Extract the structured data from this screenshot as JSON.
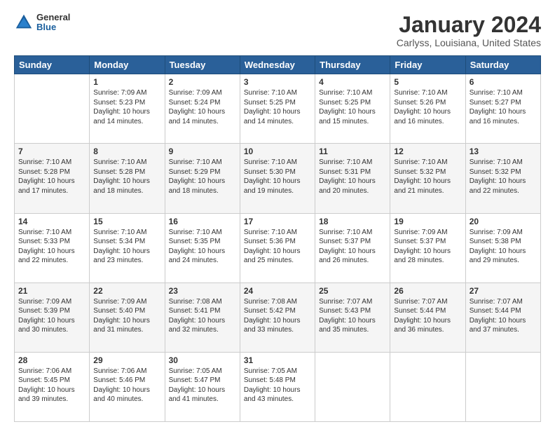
{
  "logo": {
    "line1": "General",
    "line2": "Blue"
  },
  "title": "January 2024",
  "subtitle": "Carlyss, Louisiana, United States",
  "weekdays": [
    "Sunday",
    "Monday",
    "Tuesday",
    "Wednesday",
    "Thursday",
    "Friday",
    "Saturday"
  ],
  "weeks": [
    [
      {
        "day": "",
        "info": ""
      },
      {
        "day": "1",
        "info": "Sunrise: 7:09 AM\nSunset: 5:23 PM\nDaylight: 10 hours\nand 14 minutes."
      },
      {
        "day": "2",
        "info": "Sunrise: 7:09 AM\nSunset: 5:24 PM\nDaylight: 10 hours\nand 14 minutes."
      },
      {
        "day": "3",
        "info": "Sunrise: 7:10 AM\nSunset: 5:25 PM\nDaylight: 10 hours\nand 14 minutes."
      },
      {
        "day": "4",
        "info": "Sunrise: 7:10 AM\nSunset: 5:25 PM\nDaylight: 10 hours\nand 15 minutes."
      },
      {
        "day": "5",
        "info": "Sunrise: 7:10 AM\nSunset: 5:26 PM\nDaylight: 10 hours\nand 16 minutes."
      },
      {
        "day": "6",
        "info": "Sunrise: 7:10 AM\nSunset: 5:27 PM\nDaylight: 10 hours\nand 16 minutes."
      }
    ],
    [
      {
        "day": "7",
        "info": "Sunrise: 7:10 AM\nSunset: 5:28 PM\nDaylight: 10 hours\nand 17 minutes."
      },
      {
        "day": "8",
        "info": "Sunrise: 7:10 AM\nSunset: 5:28 PM\nDaylight: 10 hours\nand 18 minutes."
      },
      {
        "day": "9",
        "info": "Sunrise: 7:10 AM\nSunset: 5:29 PM\nDaylight: 10 hours\nand 18 minutes."
      },
      {
        "day": "10",
        "info": "Sunrise: 7:10 AM\nSunset: 5:30 PM\nDaylight: 10 hours\nand 19 minutes."
      },
      {
        "day": "11",
        "info": "Sunrise: 7:10 AM\nSunset: 5:31 PM\nDaylight: 10 hours\nand 20 minutes."
      },
      {
        "day": "12",
        "info": "Sunrise: 7:10 AM\nSunset: 5:32 PM\nDaylight: 10 hours\nand 21 minutes."
      },
      {
        "day": "13",
        "info": "Sunrise: 7:10 AM\nSunset: 5:32 PM\nDaylight: 10 hours\nand 22 minutes."
      }
    ],
    [
      {
        "day": "14",
        "info": "Sunrise: 7:10 AM\nSunset: 5:33 PM\nDaylight: 10 hours\nand 22 minutes."
      },
      {
        "day": "15",
        "info": "Sunrise: 7:10 AM\nSunset: 5:34 PM\nDaylight: 10 hours\nand 23 minutes."
      },
      {
        "day": "16",
        "info": "Sunrise: 7:10 AM\nSunset: 5:35 PM\nDaylight: 10 hours\nand 24 minutes."
      },
      {
        "day": "17",
        "info": "Sunrise: 7:10 AM\nSunset: 5:36 PM\nDaylight: 10 hours\nand 25 minutes."
      },
      {
        "day": "18",
        "info": "Sunrise: 7:10 AM\nSunset: 5:37 PM\nDaylight: 10 hours\nand 26 minutes."
      },
      {
        "day": "19",
        "info": "Sunrise: 7:09 AM\nSunset: 5:37 PM\nDaylight: 10 hours\nand 28 minutes."
      },
      {
        "day": "20",
        "info": "Sunrise: 7:09 AM\nSunset: 5:38 PM\nDaylight: 10 hours\nand 29 minutes."
      }
    ],
    [
      {
        "day": "21",
        "info": "Sunrise: 7:09 AM\nSunset: 5:39 PM\nDaylight: 10 hours\nand 30 minutes."
      },
      {
        "day": "22",
        "info": "Sunrise: 7:09 AM\nSunset: 5:40 PM\nDaylight: 10 hours\nand 31 minutes."
      },
      {
        "day": "23",
        "info": "Sunrise: 7:08 AM\nSunset: 5:41 PM\nDaylight: 10 hours\nand 32 minutes."
      },
      {
        "day": "24",
        "info": "Sunrise: 7:08 AM\nSunset: 5:42 PM\nDaylight: 10 hours\nand 33 minutes."
      },
      {
        "day": "25",
        "info": "Sunrise: 7:07 AM\nSunset: 5:43 PM\nDaylight: 10 hours\nand 35 minutes."
      },
      {
        "day": "26",
        "info": "Sunrise: 7:07 AM\nSunset: 5:44 PM\nDaylight: 10 hours\nand 36 minutes."
      },
      {
        "day": "27",
        "info": "Sunrise: 7:07 AM\nSunset: 5:44 PM\nDaylight: 10 hours\nand 37 minutes."
      }
    ],
    [
      {
        "day": "28",
        "info": "Sunrise: 7:06 AM\nSunset: 5:45 PM\nDaylight: 10 hours\nand 39 minutes."
      },
      {
        "day": "29",
        "info": "Sunrise: 7:06 AM\nSunset: 5:46 PM\nDaylight: 10 hours\nand 40 minutes."
      },
      {
        "day": "30",
        "info": "Sunrise: 7:05 AM\nSunset: 5:47 PM\nDaylight: 10 hours\nand 41 minutes."
      },
      {
        "day": "31",
        "info": "Sunrise: 7:05 AM\nSunset: 5:48 PM\nDaylight: 10 hours\nand 43 minutes."
      },
      {
        "day": "",
        "info": ""
      },
      {
        "day": "",
        "info": ""
      },
      {
        "day": "",
        "info": ""
      }
    ]
  ]
}
